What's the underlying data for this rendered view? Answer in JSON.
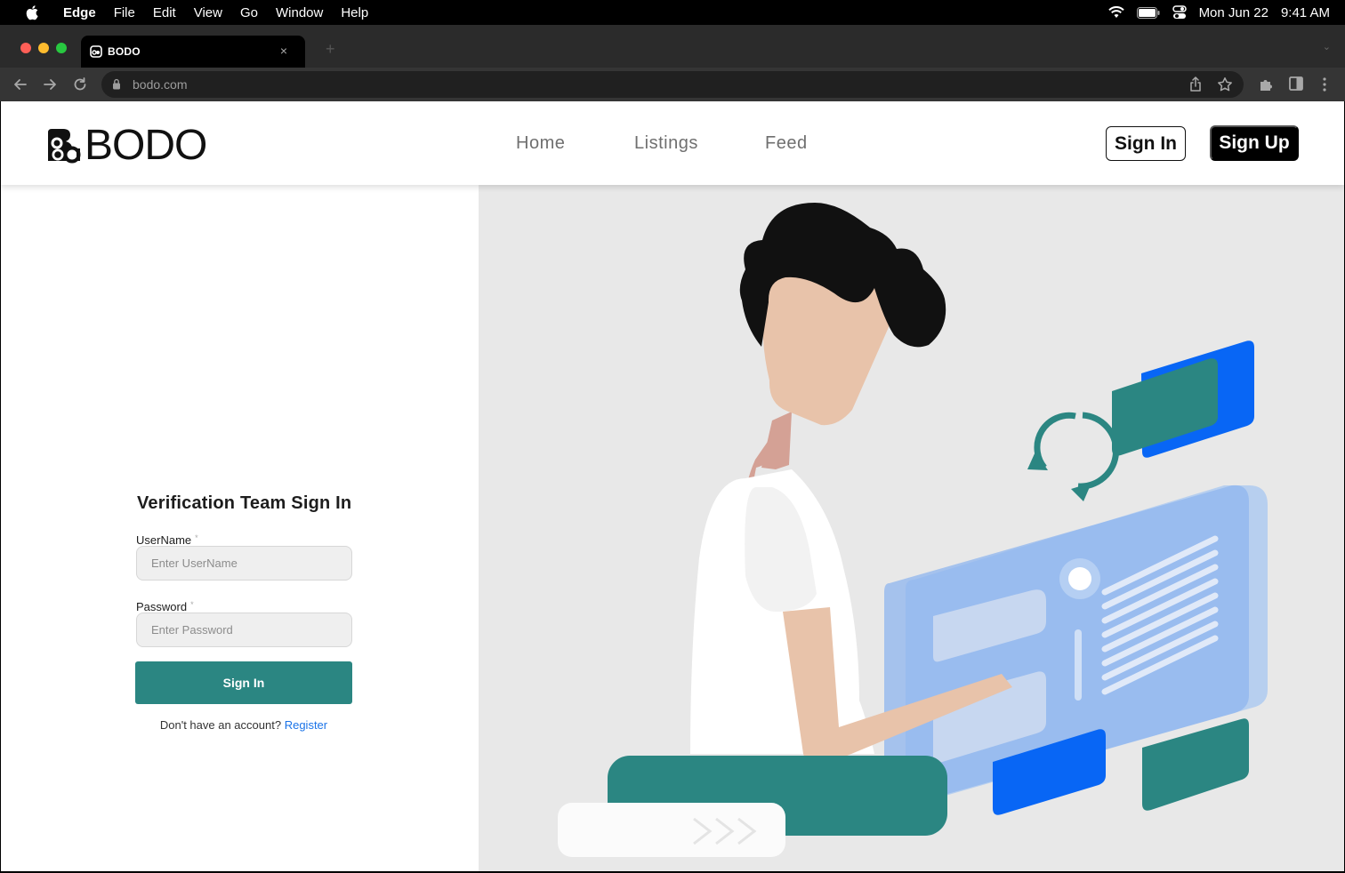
{
  "menubar": {
    "app_name": "Edge",
    "items": [
      "File",
      "Edit",
      "View",
      "Go",
      "Window",
      "Help"
    ],
    "date": "Mon Jun 22",
    "time": "9:41 AM"
  },
  "browser": {
    "tab_title": "BODO",
    "tab_close": "×",
    "new_tab": "+",
    "url": "bodo.com"
  },
  "header": {
    "logo_text": "BODO",
    "nav": {
      "home": "Home",
      "listings": "Listings",
      "feed": "Feed"
    },
    "sign_in": "Sign In",
    "sign_up": "Sign Up"
  },
  "form": {
    "title": "Verification Team Sign In",
    "username_label": "UserName",
    "username_placeholder": "Enter UserName",
    "password_label": "Password",
    "password_placeholder": "Enter Password",
    "required_mark": "*",
    "submit": "Sign In",
    "no_account": "Don't have an account?",
    "register": "Register"
  },
  "colors": {
    "teal": "#2b8682",
    "blue": "#0866f5",
    "illustration_bg": "#e8e8e8"
  }
}
